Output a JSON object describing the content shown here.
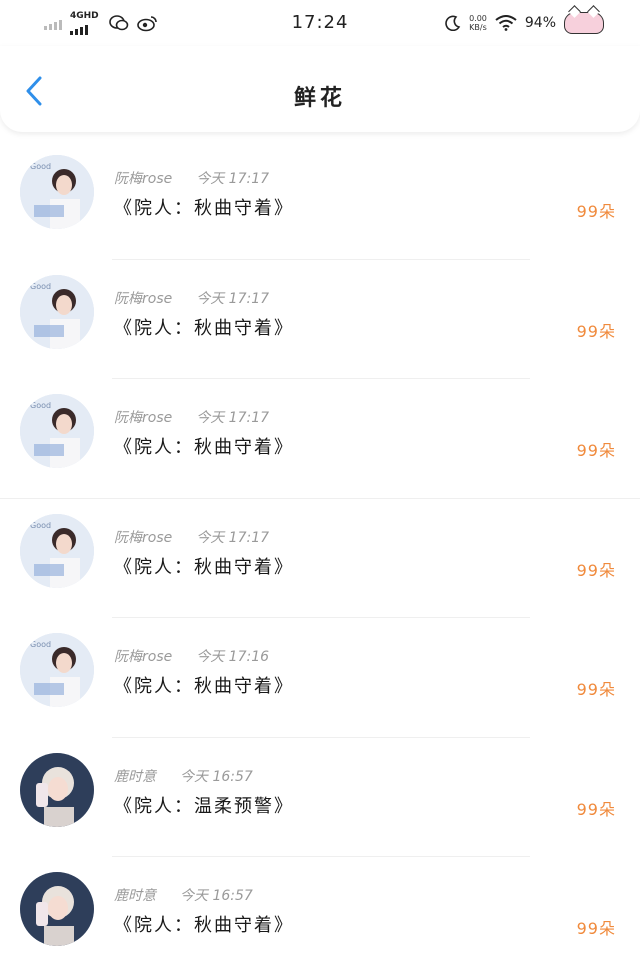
{
  "status_bar": {
    "network": "4GHD",
    "time": "17:24",
    "speed_value": "0.00",
    "speed_unit": "KB/s",
    "battery": "94%",
    "icons": [
      "signal-icon",
      "wechat-icon",
      "weibo-icon",
      "moon-icon",
      "wifi-icon",
      "cat-battery-icon"
    ]
  },
  "header": {
    "title": "鲜花",
    "back_icon": "chevron-left-icon",
    "accent": "#2f8fea"
  },
  "rows": [
    {
      "user": "阮梅rose",
      "time": "今天 17:17",
      "message": "《院人：秋曲守着》",
      "count": "99朵",
      "avatar": "a"
    },
    {
      "user": "阮梅rose",
      "time": "今天 17:17",
      "message": "《院人：秋曲守着》",
      "count": "99朵",
      "avatar": "a"
    },
    {
      "user": "阮梅rose",
      "time": "今天 17:17",
      "message": "《院人：秋曲守着》",
      "count": "99朵",
      "avatar": "a"
    },
    {
      "user": "阮梅rose",
      "time": "今天 17:17",
      "message": "《院人：秋曲守着》",
      "count": "99朵",
      "avatar": "a"
    },
    {
      "user": "阮梅rose",
      "time": "今天 17:16",
      "message": "《院人：秋曲守着》",
      "count": "99朵",
      "avatar": "a"
    },
    {
      "user": "鹿时意",
      "time": "今天 16:57",
      "message": "《院人：温柔预警》",
      "count": "99朵",
      "avatar": "b"
    },
    {
      "user": "鹿时意",
      "time": "今天 16:57",
      "message": "《院人：秋曲守着》",
      "count": "99朵",
      "avatar": "b"
    }
  ],
  "colors": {
    "count": "#f08a3c",
    "meta": "#9a9a9a"
  }
}
